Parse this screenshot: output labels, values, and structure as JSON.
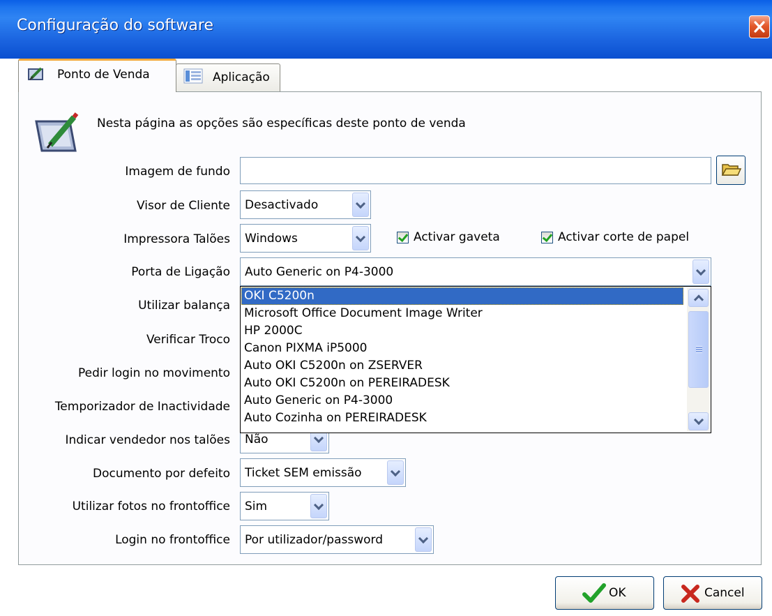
{
  "window": {
    "title": "Configuração do software"
  },
  "tabs": [
    {
      "label": "Ponto de Venda",
      "icon": "pos-icon",
      "active": true
    },
    {
      "label": "Aplicação",
      "icon": "list-icon",
      "active": false
    }
  ],
  "description": "Nesta página as opções são específicas deste ponto de venda",
  "fields": {
    "imagem_fundo": {
      "label": "Imagem de fundo",
      "value": ""
    },
    "visor_cliente": {
      "label": "Visor de Cliente",
      "value": "Desactivado"
    },
    "impressora_taloes": {
      "label": "Impressora Talões",
      "value": "Windows"
    },
    "activar_gaveta": {
      "label": "Activar gaveta",
      "checked": true
    },
    "activar_corte": {
      "label": "Activar corte de papel",
      "checked": true
    },
    "porta_ligacao": {
      "label": "Porta de Ligação",
      "value": "Auto Generic on P4-3000"
    },
    "utilizar_balanca": {
      "label": "Utilizar balança"
    },
    "verificar_troco": {
      "label": "Verificar Troco"
    },
    "pedir_login": {
      "label": "Pedir login no movimento"
    },
    "temporizador": {
      "label": "Temporizador de Inactividade"
    },
    "indicar_vendedor": {
      "label": "Indicar vendedor nos talões",
      "value": "Não"
    },
    "documento_defeito": {
      "label": "Documento por defeito",
      "value": "Ticket SEM emissão"
    },
    "fotos_frontoffice": {
      "label": "Utilizar fotos no frontoffice",
      "value": "Sim"
    },
    "login_frontoffice": {
      "label": "Login no frontoffice",
      "value": "Por utilizador/password"
    }
  },
  "dropdown": {
    "selected_index": 0,
    "options": [
      "OKI C5200n",
      "Microsoft Office Document Image Writer",
      "HP 2000C",
      "Canon PIXMA iP5000",
      "Auto OKI C5200n on ZSERVER",
      "Auto OKI C5200n on PEREIRADESK",
      "Auto Generic on P4-3000",
      "Auto Cozinha on PEREIRADESK"
    ]
  },
  "buttons": {
    "ok": "OK",
    "cancel": "Cancel"
  },
  "colors": {
    "titlebar": "#1d6ae5",
    "selection": "#316ac5",
    "tab_highlight": "#f3a93a",
    "check": "#21a121"
  }
}
